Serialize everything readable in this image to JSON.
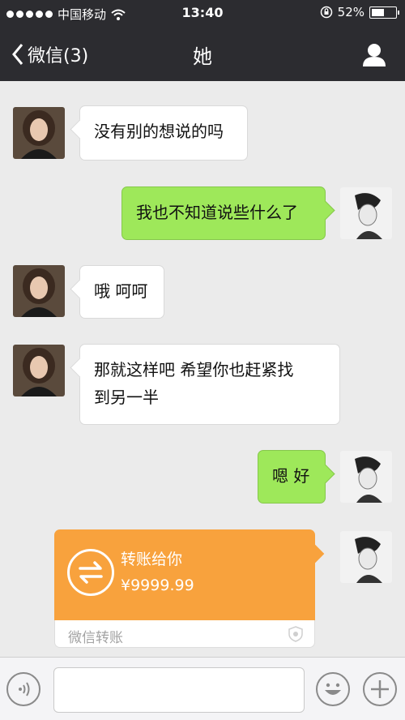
{
  "status_bar": {
    "carrier": "中国移动",
    "time": "13:40",
    "battery_percent": "52%",
    "battery_level": 0.52
  },
  "nav": {
    "back_label": "微信(3)",
    "title": "她"
  },
  "messages": [
    {
      "side": "left",
      "text": "没有别的想说的吗"
    },
    {
      "side": "right",
      "text": "我也不知道说些什么了"
    },
    {
      "side": "left",
      "text": "哦 呵呵"
    },
    {
      "side": "left",
      "text_line1": "那就这样吧 希望你也赶紧找",
      "text_line2": "到另一半"
    },
    {
      "side": "right",
      "text": "嗯 好"
    }
  ],
  "transfer": {
    "title": "转账给你",
    "amount": "¥9999.99",
    "source": "微信转账"
  },
  "colors": {
    "nav_bg": "#2c2c30",
    "green_bubble": "#9ee85a",
    "transfer_orange": "#f8a23d",
    "chat_bg": "#ebebeb"
  }
}
